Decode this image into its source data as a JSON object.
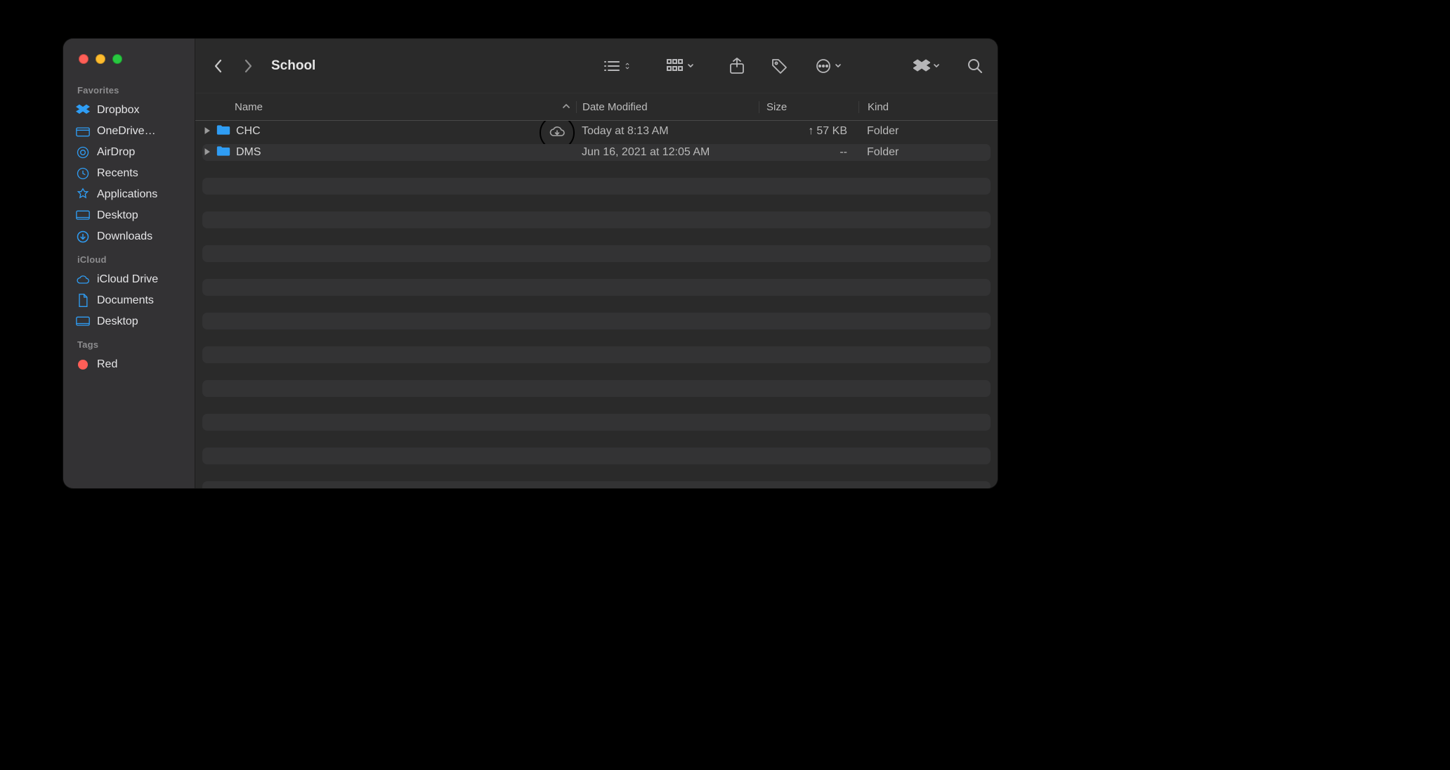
{
  "window_title": "School",
  "traffic_lights": [
    "close",
    "minimize",
    "zoom"
  ],
  "sidebar": {
    "sections": [
      {
        "title": "Favorites",
        "items": [
          {
            "icon": "dropbox",
            "label": "Dropbox"
          },
          {
            "icon": "onedrive",
            "label": "OneDrive…"
          },
          {
            "icon": "airdrop",
            "label": "AirDrop"
          },
          {
            "icon": "recents",
            "label": "Recents"
          },
          {
            "icon": "applications",
            "label": "Applications"
          },
          {
            "icon": "desktop",
            "label": "Desktop"
          },
          {
            "icon": "downloads",
            "label": "Downloads"
          }
        ]
      },
      {
        "title": "iCloud",
        "items": [
          {
            "icon": "icloud",
            "label": "iCloud Drive"
          },
          {
            "icon": "documents",
            "label": "Documents"
          },
          {
            "icon": "desktop",
            "label": "Desktop"
          }
        ]
      },
      {
        "title": "Tags",
        "items": [
          {
            "icon": "tag-red",
            "label": "Red",
            "color": "#ff5e57"
          }
        ]
      }
    ]
  },
  "toolbar": {
    "view_mode": "list",
    "icons": [
      "view-list",
      "group-by",
      "share",
      "tags",
      "actions",
      "dropbox-menu",
      "search"
    ]
  },
  "columns": {
    "name": "Name",
    "modified": "Date Modified",
    "size": "Size",
    "kind": "Kind",
    "sort_column": "Name",
    "sort_direction": "ascending"
  },
  "rows": [
    {
      "name": "CHC",
      "modified": "Today at 8:13 AM",
      "size": "57 KB",
      "size_prefix": "↑",
      "kind": "Folder",
      "cloud_download_available": true
    },
    {
      "name": "DMS",
      "modified": "Jun 16, 2021 at 12:05 AM",
      "size": "--",
      "size_prefix": "",
      "kind": "Folder",
      "cloud_download_available": false
    }
  ],
  "annotation": {
    "circled_element": "cloud-download-icon on row CHC"
  }
}
